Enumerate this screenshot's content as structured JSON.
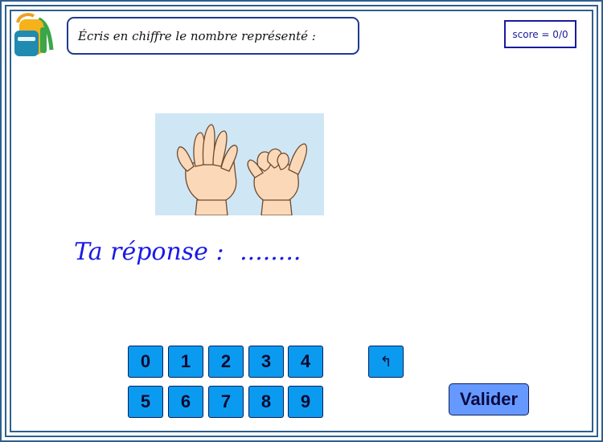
{
  "header": {
    "instruction": "Écris en chiffre le nombre représenté :",
    "score": "score = 0/0"
  },
  "answer": {
    "label": "Ta réponse :",
    "placeholder": "........"
  },
  "keypad": {
    "row1": [
      "0",
      "1",
      "2",
      "3",
      "4"
    ],
    "row2": [
      "5",
      "6",
      "7",
      "8",
      "9"
    ],
    "backspace": "↰"
  },
  "validate_label": "Valider",
  "icons": {
    "logo": "backpack-icon",
    "image": "hands-counting-image"
  },
  "colors": {
    "key": "#0a9bf0",
    "validate": "#6699ff",
    "answer_text": "#1a1ae6",
    "border": "#2f5f8f"
  }
}
